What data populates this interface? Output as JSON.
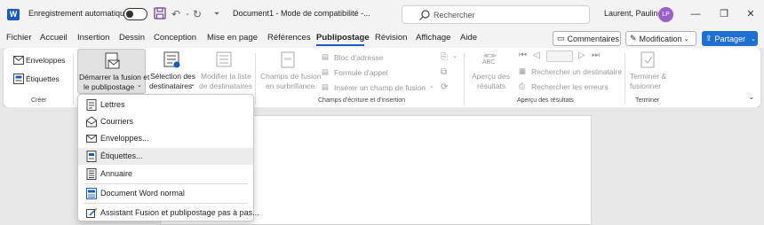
{
  "titlebar": {
    "app_logo": "W",
    "autosave_label": "Enregistrement automatique",
    "document_title": "Document1  -  Mode de compatibilité  -...",
    "search_placeholder": "Rechercher",
    "user_name": "Laurent, Pauline",
    "user_initials": "LP"
  },
  "menu": {
    "tabs": [
      "Fichier",
      "Accueil",
      "Insertion",
      "Dessin",
      "Conception",
      "Mise en page",
      "Références",
      "Publipostage",
      "Révision",
      "Affichage",
      "Aide"
    ],
    "active_tab": "Publipostage",
    "comments_label": "Commentaires",
    "editing_label": "Modification",
    "share_label": "Partager"
  },
  "ribbon": {
    "creer": {
      "group_label": "Créer",
      "enveloppes": "Enveloppes",
      "etiquettes": "Étiquettes"
    },
    "demarrer": {
      "start_merge_line1": "Démarrer la fusion et",
      "start_merge_line2": "le publipostage",
      "select_recipients_line1": "Sélection des",
      "select_recipients_line2": "destinataires",
      "edit_list_line1": "Modifier la liste",
      "edit_list_line2": "de destinataires"
    },
    "champs": {
      "group_label": "Champs d'écriture et d'insertion",
      "highlight_line1": "Champs de fusion",
      "highlight_line2": "en surbrillance",
      "bloc_adresse": "Bloc d'adresse",
      "formule_appel": "Formule d'appel",
      "inserer_champ": "Insérer un champ de fusion"
    },
    "apercu": {
      "group_label": "Aperçu des résultats",
      "abc_top": "≪≫",
      "abc_bottom": "ABC",
      "preview_line1": "Aperçu des",
      "preview_line2": "résultats",
      "find_recipient": "Rechercher un destinataire",
      "check_errors": "Rechercher les erreurs"
    },
    "terminer": {
      "group_label": "Terminer",
      "finish_line1": "Terminer &",
      "finish_line2": "fusionner"
    }
  },
  "dropdown": {
    "items": [
      {
        "label": "Lettres",
        "icon": "letter-icon"
      },
      {
        "label": "Courriers",
        "icon": "envelope-open-icon"
      },
      {
        "label": "Enveloppes...",
        "icon": "envelope-icon"
      },
      {
        "label": "Étiquettes...",
        "icon": "label-icon"
      },
      {
        "label": "Annuaire",
        "icon": "directory-icon"
      },
      {
        "label": "Document Word normal",
        "icon": "word-document-icon"
      },
      {
        "label": "Assistant Fusion et publipostage pas à pas...",
        "icon": "wizard-icon"
      }
    ]
  },
  "colors": {
    "accent": "#185abd",
    "share_button": "#1f6fd0",
    "avatar": "#9b5fc9"
  }
}
